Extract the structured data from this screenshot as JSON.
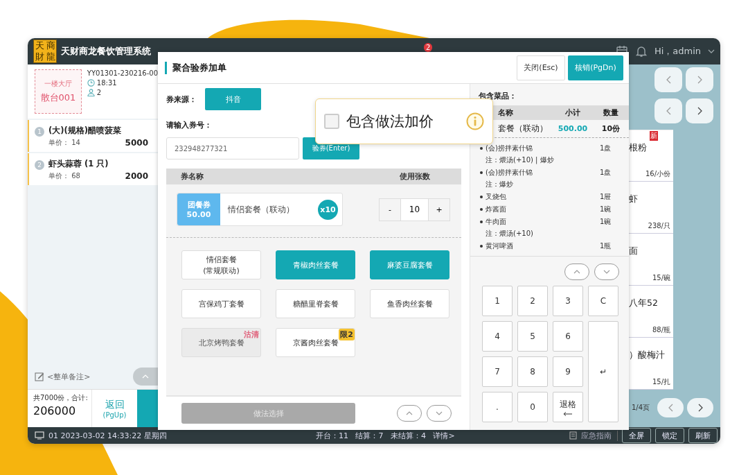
{
  "app": {
    "logo_chars": [
      "天",
      "商",
      "財",
      "龍"
    ],
    "title": "天财商龙餐饮管理系统",
    "nav_badge": "2",
    "user": "Hi，admin"
  },
  "order": {
    "area": "一楼大厅",
    "table": "散台001",
    "order_no": "YY01301-230216-00",
    "time": "18:31",
    "guests": "2",
    "items": [
      {
        "index": "1",
        "name": "(大)(规格)醋喷菠菜",
        "price_label": "单价：",
        "price": "14",
        "qty": "5000"
      },
      {
        "index": "2",
        "name": "虾头蒜蓉 (1 只)",
        "price_label": "单价：",
        "price": "68",
        "qty": "2000"
      }
    ],
    "remark": "<整单备注>",
    "total_label": "共7000份，合计:",
    "total": "206000",
    "back_label": "返回",
    "back_key": "(PgUp)"
  },
  "menu": {
    "cards": [
      {
        "name": "根粉",
        "price": "16/小份",
        "is_new": true,
        "new_label": "新"
      },
      {
        "name": "虾",
        "price": "238/只",
        "is_new": false
      },
      {
        "name": "面",
        "price": "15/碗",
        "is_new": false
      },
      {
        "name": "八年52",
        "price": "88/瓶",
        "is_new": false
      },
      {
        "name": "）酸梅汁",
        "price": "15/扎",
        "is_new": false
      }
    ],
    "page": "1/4页"
  },
  "status_bar": {
    "terminal": "01 2023-03-02 14:33:22 星期四",
    "stats": "开台：11   结算：7   未结算：4   详情>",
    "guide": "应急指南",
    "buttons": [
      "全屏",
      "锁定",
      "刷新"
    ]
  },
  "dialog": {
    "title": "聚合验券加单",
    "close": "关闭(Esc)",
    "confirm": "核销(PgDn)",
    "source_label": "券来源：",
    "source": "抖音",
    "code_label": "请输入券号：",
    "code": "232948277321",
    "verify": "验券(Enter)",
    "columns": [
      "券名称",
      "使用张数"
    ],
    "coupon": {
      "type": "团餐券",
      "value": "50.00",
      "name": "情侣套餐（联动）",
      "badge": "x10",
      "minus": "-",
      "count": "10",
      "plus": "+"
    },
    "packages": [
      {
        "label": "情侣套餐",
        "sub": "(常规联动)",
        "selected": false,
        "disabled": false
      },
      {
        "label": "青椒肉丝套餐",
        "selected": true,
        "disabled": false
      },
      {
        "label": "麻婆豆腐套餐",
        "selected": true,
        "disabled": false
      },
      {
        "label": "宫保鸡丁套餐",
        "selected": false,
        "disabled": false
      },
      {
        "label": "糖醋里脊套餐",
        "selected": false,
        "disabled": false
      },
      {
        "label": "鱼香肉丝套餐",
        "selected": false,
        "disabled": false
      },
      {
        "label": "北京烤鸭套餐",
        "selected": false,
        "disabled": true,
        "tag": {
          "label": "沽清",
          "kind": "soldout"
        }
      },
      {
        "label": "京酱肉丝套餐",
        "selected": false,
        "disabled": false,
        "tag": {
          "label": "限2",
          "kind": "limit"
        }
      }
    ],
    "method_button": {
      "label": "做法选择",
      "disabled": true
    },
    "dishes_label": "包含菜品：",
    "dish_columns": [
      "名称",
      "小计",
      "数量"
    ],
    "package_row": {
      "name": "套餐（联动）",
      "subtotal": "500.00",
      "qty": "10份"
    },
    "dishes": [
      {
        "name": "(会)捞拌素什锦",
        "note": "注：煨汤(+10) | 爆炒",
        "qty": "1盘"
      },
      {
        "name": "(会)捞拌素什锦",
        "note": "注：爆炒",
        "qty": "1盘"
      },
      {
        "name": "叉烧包",
        "qty": "1屉"
      },
      {
        "name": "炸酱面",
        "qty": "1碗"
      },
      {
        "name": "牛肉面",
        "note": "注：煨汤(+10)",
        "qty": "1碗"
      },
      {
        "name": "黄河啤酒",
        "qty": "1瓶"
      }
    ],
    "keypad": [
      {
        "label": "1",
        "kind": "key"
      },
      {
        "label": "2",
        "kind": "key"
      },
      {
        "label": "3",
        "kind": "key"
      },
      {
        "label": "C",
        "kind": "key"
      },
      {
        "label": "4",
        "kind": "key"
      },
      {
        "label": "5",
        "kind": "key"
      },
      {
        "label": "6",
        "kind": "key"
      },
      {
        "label": "7",
        "kind": "key"
      },
      {
        "label": "8",
        "kind": "key"
      },
      {
        "label": "9",
        "kind": "key"
      },
      {
        "label": "↵",
        "kind": "enter"
      },
      {
        "label": ".",
        "kind": "key"
      },
      {
        "label": "0",
        "kind": "key"
      },
      {
        "label": "退格",
        "kind": "backspace"
      }
    ]
  },
  "popover": {
    "label": "包含做法加价",
    "checked": false
  }
}
